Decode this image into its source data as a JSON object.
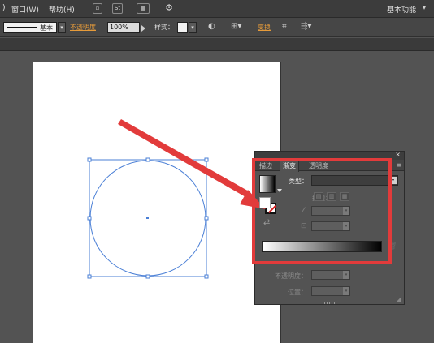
{
  "menu": {
    "items": [
      "窗口(W)",
      "帮助(H)"
    ],
    "workspace": "基本功能",
    "icons": [
      "br-icon",
      "st-icon",
      "arrange-documents-icon",
      "gpu-performance-icon"
    ],
    "st_label": "St"
  },
  "control_bar": {
    "stroke_style": "基本",
    "opacity_label": "不透明度",
    "opacity_value": "100%",
    "style_label": "样式：",
    "recolor_label": "变换"
  },
  "gradient_panel": {
    "tabs": [
      "描边",
      "渐变",
      "透明度"
    ],
    "active_tab": "渐变",
    "type_label": "类型：",
    "type_value": "",
    "stroke_label": "描边：",
    "opacity_label": "不透明度：",
    "location_label": "位置：",
    "gradient_start_color": "#ffffff",
    "gradient_end_color": "#000000"
  },
  "colors": {
    "highlight": "#e23b3b",
    "accent_orange": "#e69b3a",
    "selection_blue": "#4a7fd6"
  }
}
